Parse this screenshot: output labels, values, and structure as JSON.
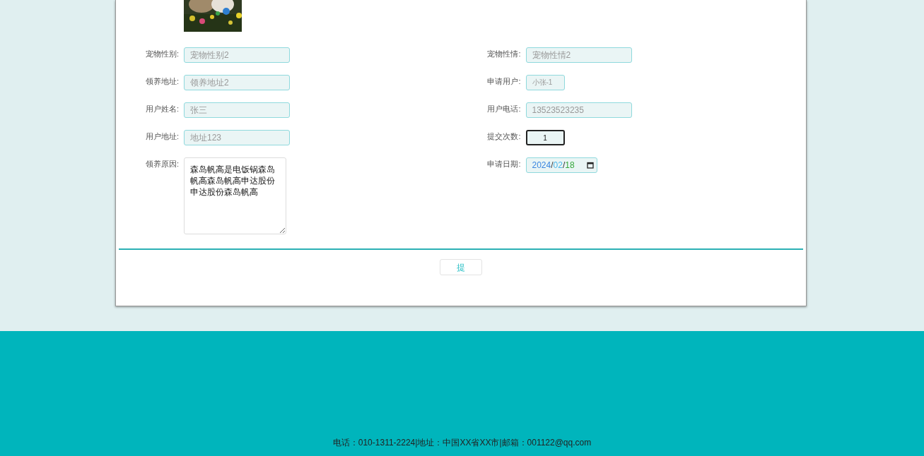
{
  "form": {
    "columns": [
      {
        "fields": [
          {
            "label": "宠物性别:",
            "kind": "text",
            "value": "宠物性别2",
            "focused": false
          },
          {
            "label": "领养地址:",
            "kind": "text",
            "value": "领养地址2",
            "focused": false
          },
          {
            "label": "用户姓名:",
            "kind": "text",
            "value": "张三",
            "focused": false
          },
          {
            "label": "用户地址:",
            "kind": "text",
            "value": "地址123",
            "focused": false
          },
          {
            "label": "领养原因:",
            "kind": "textarea",
            "value": "森岛帆高是电饭锅森岛帆高森岛帆高申达股份申达股份森岛帆高",
            "focused": false
          }
        ]
      },
      {
        "fields": [
          {
            "label": "宠物性情:",
            "kind": "text",
            "value": "宠物性情2",
            "focused": false
          },
          {
            "label": "申请用户:",
            "kind": "short",
            "value": "小张-1",
            "focused": false
          },
          {
            "label": "用户电话:",
            "kind": "text",
            "value": "13523523235",
            "focused": false
          },
          {
            "label": "提交次数:",
            "kind": "number",
            "value": "1",
            "focused": true
          },
          {
            "label": "申请日期:",
            "kind": "date",
            "value": "2024/02/18",
            "focused": false
          }
        ]
      }
    ]
  },
  "submit_button": {
    "label": "提"
  },
  "footer": {
    "text": "电话：010-1311-2224|地址：中国XX省XX市|邮箱：001122@qq.com"
  }
}
